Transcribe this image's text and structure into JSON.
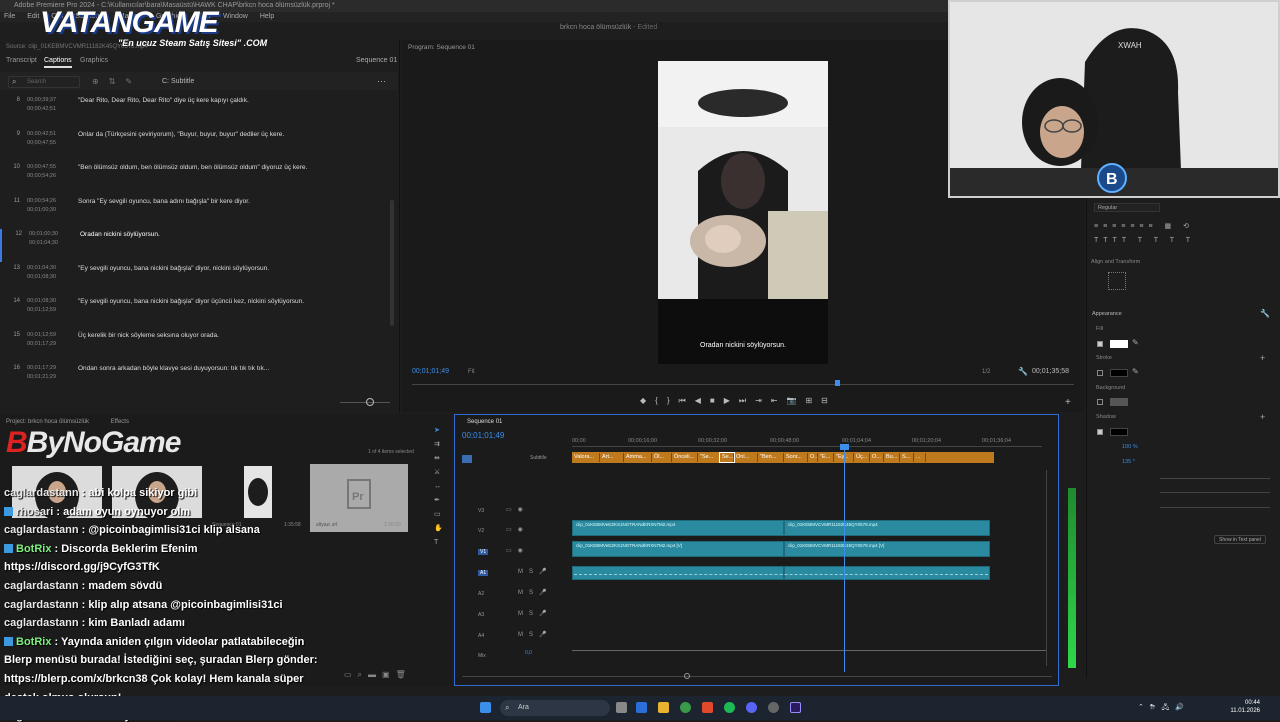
{
  "app": {
    "title": "Adobe Premiere Pro 2024 - C:\\Kullanıcılar\\bara\\Masaüstü\\HAWK CHAP\\brkcn hoca ölümsüzlük.prproj *",
    "menu": [
      "File",
      "Edit",
      "Clip",
      "Sequence",
      "Markers",
      "Graphics",
      "View",
      "Window",
      "Help"
    ],
    "workspace_title": "brkcn hoca ölümsüzlük",
    "workspace_status": "- Edited"
  },
  "overlays": {
    "vatan_logo": "VATANGAME",
    "vatan_sub": "\"En ucuz Steam Satış Sitesi\" .COM",
    "bynogame": "ByNoGame"
  },
  "source_panel": {
    "source_header": "Source: clip_01KEBMVCVMR11182K45QY0578.mp4",
    "tabs": [
      "Transcript",
      "Captions",
      "Graphics"
    ],
    "active_tab": "Captions",
    "sequence_label": "Sequence 01",
    "search_placeholder": "Search",
    "track_label": "C: Subtitle",
    "captions": [
      {
        "num": "8",
        "in": "00;00;39;37",
        "out": "00;00;42;51",
        "text": "\"Dear Rito, Dear Rito, Dear Rito\" diye üç kere kapıyı çaldık."
      },
      {
        "num": "9",
        "in": "00;00;42;51",
        "out": "00;00;47;55",
        "text": "Onlar da (Türkçesini çeviriyorum), \"Buyur, buyur, buyur\" dediler üç kere."
      },
      {
        "num": "10",
        "in": "00;00;47;55",
        "out": "00;00;54;26",
        "text": "\"Ben ölümsüz oldum, ben ölümsüz oldum, ben ölümsüz oldum\" diyoruz üç kere."
      },
      {
        "num": "11",
        "in": "00;00;54;26",
        "out": "00;01;00;30",
        "text": "Sonra \"Ey sevgili oyuncu, bana adını bağışla\" bir kere diyor."
      },
      {
        "num": "12",
        "in": "00;01;00;30",
        "out": "00;01;04;30",
        "text": "Oradan nickini söylüyorsun."
      },
      {
        "num": "13",
        "in": "00;01;04;30",
        "out": "00;01;08;30",
        "text": "\"Ey sevgili oyuncu, bana nickini bağışla\" diyor, nickini söylüyorsun."
      },
      {
        "num": "14",
        "in": "00;01;08;30",
        "out": "00;01;12;59",
        "text": "\"Ey sevgili oyuncu, bana nickini bağışla\" diyor üçüncü kez, nickini söylüyorsun."
      },
      {
        "num": "15",
        "in": "00;01;12;59",
        "out": "00;01;17;29",
        "text": "Üç kerelik bir nick söyleme seksına oluyor orada."
      },
      {
        "num": "16",
        "in": "00;01;17;29",
        "out": "00;01;21;29",
        "text": "Ondan sonra arkadan böyle klavye sesi duyuyorsun: tık tık tık tık..."
      }
    ],
    "active_caption_index": 4
  },
  "program_monitor": {
    "label": "Program: Sequence 01",
    "subtitle_overlay": "Oradan nickini söylüyorsun.",
    "timecode_left": "00;01;01;49",
    "fit": "Fit",
    "resolution": "1/2",
    "timecode_right": "00;01;35;58",
    "playhead_fraction": 0.64,
    "transport": [
      "◆",
      "{",
      "}",
      "⏮",
      "◀",
      "■",
      "▶",
      "⏭",
      "⇥",
      "⇤",
      "📷",
      "⊞",
      "⊟"
    ]
  },
  "essential_graphics": {
    "font_style": "Regular",
    "section_align": "Align and Transform",
    "section_appearance": "Appearance",
    "fill_label": "Fill",
    "stroke_label": "Stroke",
    "background_label": "Background",
    "shadow_label": "Shadow",
    "show_in_text_panel": "Show in Text panel",
    "fill_color": "#ffffff",
    "stroke_color": "#000000",
    "shadow_color": "#000000",
    "shadow_opacity": "100 %",
    "shadow_angle": "135 °"
  },
  "project_panel": {
    "tabs": [
      "Project: brkcn hoca ölümsüzlük",
      "Effects"
    ],
    "items_selected": "1 of 4 items selected",
    "thumb_labels": [
      "clip_01KEBMVd...",
      "clip_01KEBM...",
      "Sequence 01",
      "altyazı.srt"
    ],
    "thumb_durations": [
      "1:35:58",
      "1:36:00"
    ]
  },
  "chat": [
    {
      "user": "caglardastann",
      "message": "abi kolpa sikiyor gibi",
      "bot": false
    },
    {
      "user": "rhosari",
      "message": "adam oyun oynuyor olm",
      "bot": false,
      "badge": true
    },
    {
      "user": "caglardastann",
      "message": "@picoinbagimlisi31ci klip alsana",
      "bot": false
    },
    {
      "user": "BotRix",
      "message": "Discorda Beklerim Efenim",
      "bot": true,
      "badge": true
    },
    {
      "user": "",
      "message": "https://discord.gg/j9CyfG3TfK",
      "bot": false
    },
    {
      "user": "caglardastann",
      "message": "madem sövdü",
      "bot": false
    },
    {
      "user": "caglardastann",
      "message": "klip alıp atsana @picoinbagimlisi31ci",
      "bot": false
    },
    {
      "user": "caglardastann",
      "message": "kim Banladı adamı",
      "bot": false
    },
    {
      "user": "BotRix",
      "message": "Yayında aniden çılgın videolar patlatabileceğin",
      "bot": true,
      "badge": true
    },
    {
      "user": "",
      "message": "Blerp menüsü burada! İstediğini seç, şuradan Blerp gönder:",
      "bot": false
    },
    {
      "user": "",
      "message": "https://blerp.com/x/brkcn38 Çok kolay! Hem kanala süper",
      "bot": false
    },
    {
      "user": "",
      "message": "destek olmuş olursun!",
      "bot": false
    },
    {
      "user": "caglardastann",
      "message": "drama yaratıxak",
      "bot": false
    }
  ],
  "timeline": {
    "tab": "Sequence 01",
    "timecode": "00;01;01;49",
    "ruler": [
      "00;00",
      "00;00;16;00",
      "00;00;32;00",
      "00;00;48;00",
      "00;01;04;04",
      "00;01;20;04",
      "00;01;36;04"
    ],
    "subtitle_track_label": "Subtitle",
    "subtitle_clips": [
      "Valora...",
      "Art...",
      "Amma...",
      "Öl...",
      "Önceli...",
      "\"Se...",
      "Se...",
      "Onl...",
      "\"Ben...",
      "Sonr...",
      "O...",
      "\"E...",
      "\"Ey...",
      "Üç...",
      "O...",
      "Bu...",
      "S...",
      "..."
    ],
    "video_tracks": [
      "V3",
      "V2",
      "V1"
    ],
    "audio_tracks": [
      "A1",
      "A2",
      "A3",
      "A4"
    ],
    "mix_label": "Mix",
    "mix_value": "0,0",
    "video_clip_a": "clip_01KEBMVeEZKS1NGTRANdKRXN7M2.mp4",
    "video_clip_a_v": "clip_01KEBMVeEZKS1NGTRANdKRXN7M2.mp4 [V]",
    "video_clip_b": "clip_01KEBMVCVMR11182K45QY0578.mp4",
    "video_clip_b_v": "clip_01KEBMVCVMR11182K45QY0578.mp4 [V]",
    "track_buttons": [
      "M",
      "S"
    ]
  },
  "taskbar": {
    "search_placeholder": "Ara",
    "time": "00:44",
    "date": "11.01.2026"
  }
}
